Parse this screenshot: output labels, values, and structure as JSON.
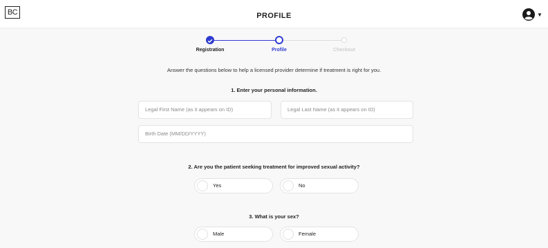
{
  "header": {
    "logo_text": "BC",
    "title": "PROFILE",
    "account_icon": "account-circle-icon",
    "menu_icon": "chevron-down-icon"
  },
  "stepper": {
    "steps": [
      {
        "label": "Registration",
        "state": "complete"
      },
      {
        "label": "Profile",
        "state": "current"
      },
      {
        "label": "Checkout",
        "state": "upcoming"
      }
    ],
    "colors": {
      "active": "#2f3bd0",
      "inactive": "#dcdcdc",
      "inactive_text": "#cfcfcf"
    }
  },
  "intro": "Answer the questions below to help a licensed provider determine if treatment is right for you.",
  "q1": {
    "title": "1. Enter your personal information.",
    "first_name_placeholder": "Legal First Name (as it appears on ID)",
    "last_name_placeholder": "Legal Last Name (as it appears on ID)",
    "birth_date_placeholder": "Birth Date (MM/DD/YYYY)"
  },
  "q2": {
    "title": "2. Are you the patient seeking treatment for improved sexual activity?",
    "options": [
      "Yes",
      "No"
    ]
  },
  "q3": {
    "title": "3. What is your sex?",
    "options": [
      "Male",
      "Female"
    ]
  }
}
